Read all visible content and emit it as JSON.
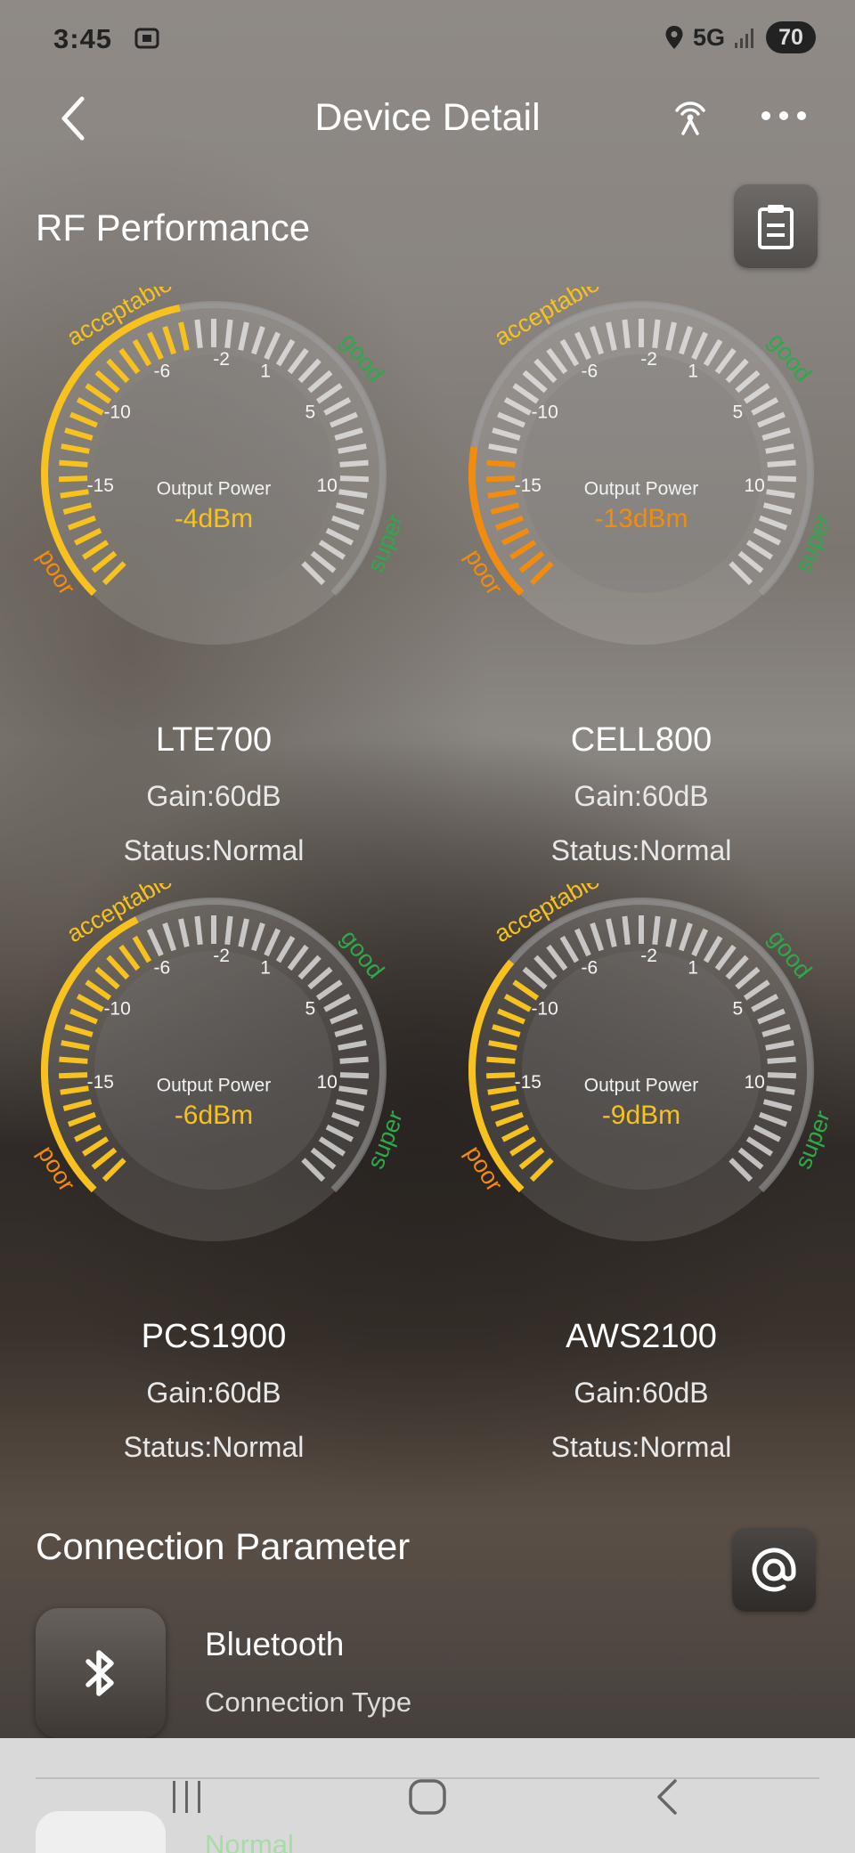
{
  "status_bar": {
    "time": "3:45",
    "network": "5G",
    "battery": "70"
  },
  "header": {
    "title": "Device Detail"
  },
  "rf": {
    "title": "RF Performance"
  },
  "gauge_labels": {
    "center_label": "Output Power",
    "zone_poor": "poor",
    "zone_acceptable": "acceptable",
    "zone_good": "good",
    "zone_super": "super",
    "scale": [
      "-15",
      "-10",
      "-6",
      "-2",
      "1",
      "5",
      "10"
    ]
  },
  "bands": [
    {
      "name": "LTE700",
      "value": -4,
      "value_text": "-4dBm",
      "color": "#f7c21e",
      "gain": "Gain:60dB",
      "status": "Status:Normal"
    },
    {
      "name": "CELL800",
      "value": -13,
      "value_text": "-13dBm",
      "color": "#f28c0f",
      "gain": "Gain:60dB",
      "status": "Status:Normal"
    },
    {
      "name": "PCS1900",
      "value": -6,
      "value_text": "-6dBm",
      "color": "#f7c21e",
      "gain": "Gain:60dB",
      "status": "Status:Normal"
    },
    {
      "name": "AWS2100",
      "value": -9,
      "value_text": "-9dBm",
      "color": "#f7c21e",
      "gain": "Gain:60dB",
      "status": "Status:Normal"
    }
  ],
  "connection": {
    "title": "Connection Parameter",
    "type_value": "Bluetooth",
    "type_label": "Connection Type",
    "next_value": "Normal"
  },
  "colors": {
    "poor": "#f28c0f",
    "acceptable": "#f7c21e",
    "good": "#2fa84a"
  },
  "icons": [
    "back-icon",
    "satellite-signal-icon",
    "more-icon",
    "clipboard-icon",
    "at-icon",
    "bluetooth-icon",
    "recent-apps-icon",
    "home-icon",
    "nav-back-icon"
  ]
}
